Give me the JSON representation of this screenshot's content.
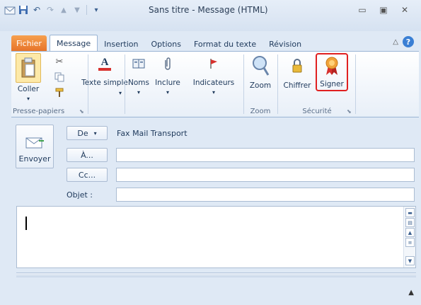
{
  "window": {
    "title": "Sans titre - Message (HTML)"
  },
  "tabs": [
    {
      "label": "Fichier"
    },
    {
      "label": "Message"
    },
    {
      "label": "Insertion"
    },
    {
      "label": "Options"
    },
    {
      "label": "Format du texte"
    },
    {
      "label": "Révision"
    }
  ],
  "ribbon": {
    "clipboard": {
      "paste_label": "Coller",
      "group_label": "Presse-papiers"
    },
    "basic_text_label": "Texte simple",
    "names_label": "Noms",
    "include_label": "Inclure",
    "tags_label": "Indicateurs",
    "zoom": {
      "zoom_label": "Zoom",
      "group_label": "Zoom"
    },
    "security": {
      "encrypt_label": "Chiffrer",
      "sign_label": "Signer",
      "group_label": "Sécurité"
    }
  },
  "form": {
    "send_label": "Envoyer",
    "from_label": "De",
    "from_value": "Fax Mail Transport",
    "to_label": "À...",
    "cc_label": "Cc...",
    "subject_label": "Objet :"
  },
  "colors": {
    "file_tab": "#e7742a",
    "sign_highlight": "#e02020"
  }
}
